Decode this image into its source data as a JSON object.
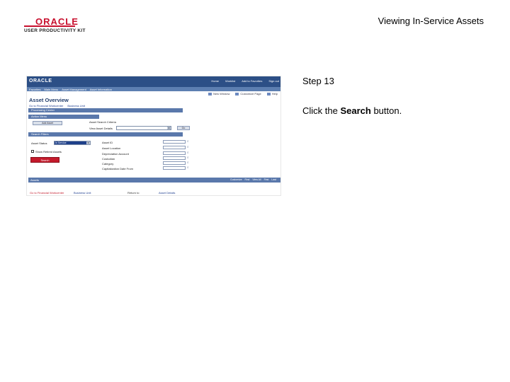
{
  "logo": {
    "brand": "ORACLE",
    "product": "USER PRODUCTIVITY KIT",
    "brand_color": "#c8102e"
  },
  "slide_title": "Viewing In-Service Assets",
  "step": {
    "number": "Step 13",
    "prefix": "Click the ",
    "target": "Search",
    "suffix": " button."
  },
  "screenshot": {
    "app_logo": "ORACLE",
    "header_links": [
      "Home",
      "Worklist",
      "Add to Favorites",
      "Sign out"
    ],
    "nav_tabs": [
      "Favorites",
      "Main Menu",
      "Asset Management",
      "Asset Information"
    ],
    "toolbar": [
      "New Window",
      "Customize Page",
      "Help"
    ],
    "page_title": "Asset Overview",
    "breadcrumb": [
      "Go to Financial Workcenter",
      "Business Unit"
    ],
    "sections": {
      "processing": "Processing Center",
      "action_menu": "Action Menu",
      "search_filters": "Search Filters"
    },
    "action_button": "Add Asset",
    "asset_label": "Asset Search Criteria",
    "view_asset_details_label": "View Asset Details",
    "go_button": "Go",
    "asset_status_label": "Asset Status",
    "asset_status_value": "In Service",
    "filter_checkbox_label": "Show Retired Assets",
    "search_button": "Search",
    "fields": [
      "Asset ID",
      "Asset Location",
      "Depreciation Account",
      "Custodian",
      "Category",
      "Capitalization Date From"
    ],
    "grid": {
      "title": "Assets",
      "nav": [
        "Customize",
        "Find",
        "View All",
        "First",
        "Last"
      ]
    },
    "bottom_links": [
      "Go to Financial Workcenter",
      "Business Unit",
      "Return to",
      "Asset Details"
    ]
  }
}
